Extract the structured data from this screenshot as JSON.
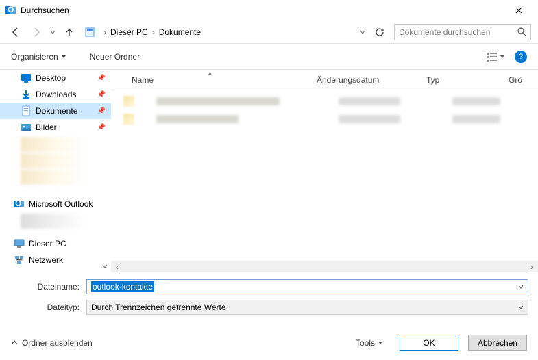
{
  "window": {
    "title": "Durchsuchen"
  },
  "nav": {
    "crumb_root": "Dieser PC",
    "crumb_folder": "Dokumente",
    "search_placeholder": "Dokumente durchsuchen"
  },
  "toolbar": {
    "organize": "Organisieren",
    "new_folder": "Neuer Ordner"
  },
  "sidebar": {
    "items": [
      {
        "label": "Desktop",
        "icon": "desktop",
        "pinned": true
      },
      {
        "label": "Downloads",
        "icon": "download",
        "pinned": true
      },
      {
        "label": "Dokumente",
        "icon": "document",
        "pinned": true,
        "selected": true
      },
      {
        "label": "Bilder",
        "icon": "pictures",
        "pinned": true
      }
    ],
    "outlook": "Microsoft Outlook",
    "this_pc": "Dieser PC",
    "network": "Netzwerk"
  },
  "columns": {
    "name": "Name",
    "modified": "Änderungsdatum",
    "type": "Typ",
    "size": "Grö"
  },
  "form": {
    "filename_label": "Dateiname:",
    "filename_value": "outlook-kontakte",
    "filetype_label": "Dateityp:",
    "filetype_value": "Durch Trennzeichen getrennte Werte"
  },
  "footer": {
    "hide_folders": "Ordner ausblenden",
    "tools": "Tools",
    "ok": "OK",
    "cancel": "Abbrechen"
  }
}
